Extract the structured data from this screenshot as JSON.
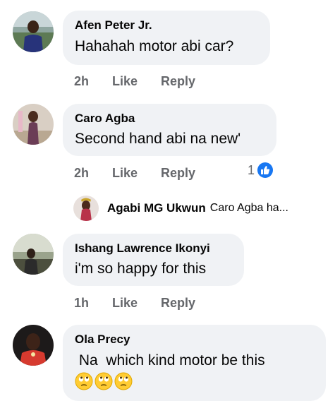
{
  "comments": [
    {
      "author": "Afen Peter Jr.",
      "text": "Hahahah motor abi car?",
      "time": "2h",
      "like_label": "Like",
      "reply_label": "Reply"
    },
    {
      "author": "Caro Agba",
      "text": "Second hand abi na new'",
      "time": "2h",
      "like_label": "Like",
      "reply_label": "Reply",
      "reaction_count": "1",
      "reaction_icon": "thumbs-up-icon",
      "reply": {
        "author": "Agabi MG Ukwun",
        "preview": "Caro Agba ha..."
      }
    },
    {
      "author": "Ishang Lawrence Ikonyi",
      "text": "i'm so happy for this",
      "time": "1h",
      "like_label": "Like",
      "reply_label": "Reply"
    },
    {
      "author": "Ola Precy",
      "text": " Na  which kind motor be this",
      "emojis": [
        "rolling-eyes-emoji",
        "rolling-eyes-emoji",
        "rolling-eyes-emoji"
      ]
    }
  ],
  "colors": {
    "bubble": "#f0f2f5",
    "meta_text": "#65676b",
    "like_blue": "#1877f2"
  }
}
